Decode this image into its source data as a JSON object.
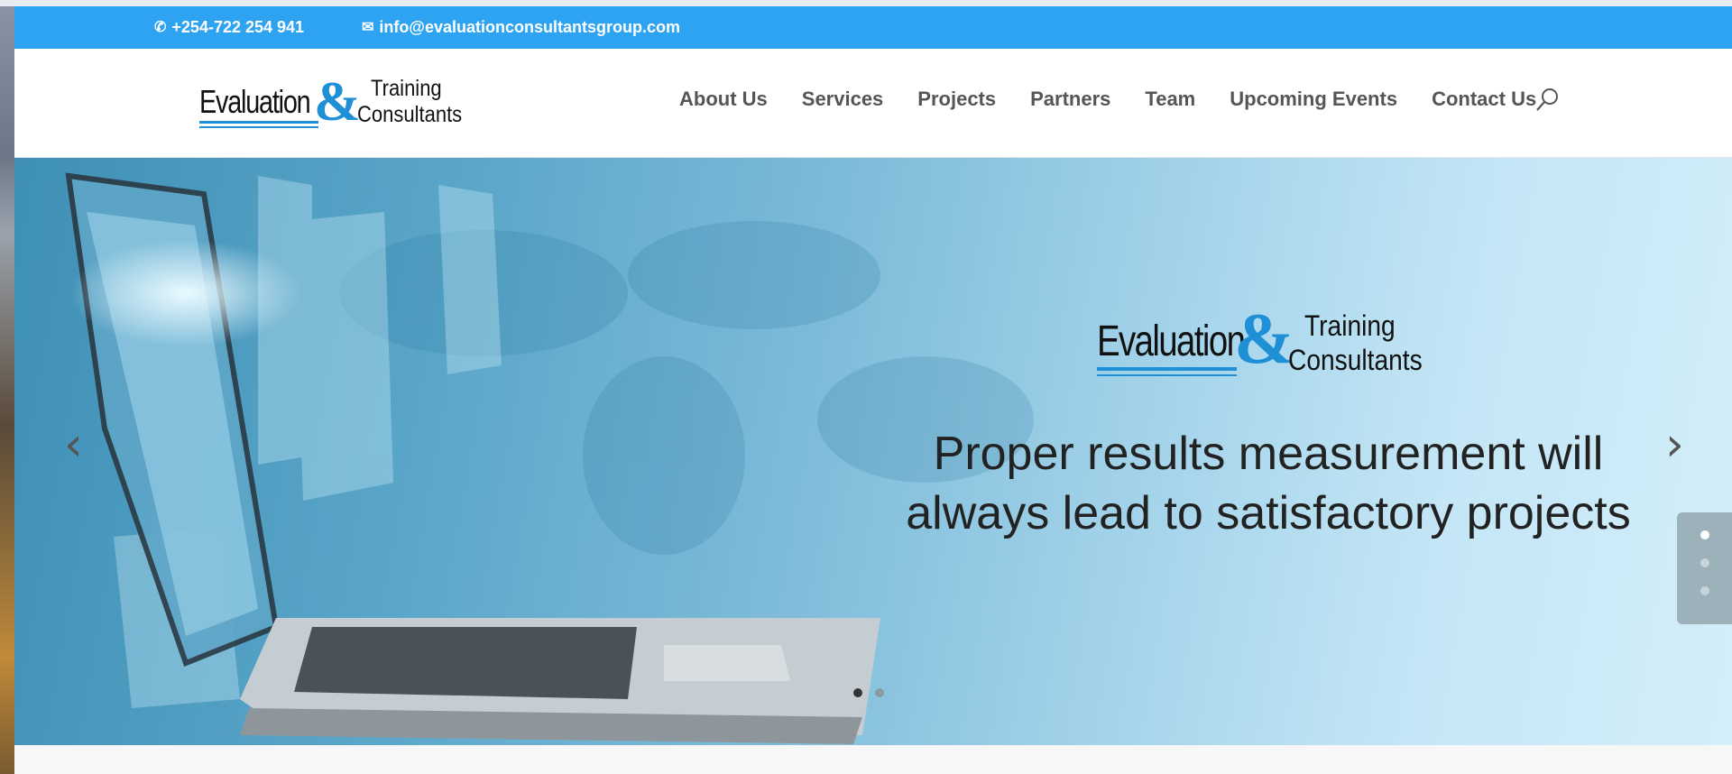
{
  "topbar": {
    "phone": "+254-722 254 941",
    "email": "info@evaluationconsultantsgroup.com",
    "bg_color": "#2ea3f2"
  },
  "logo": {
    "word1": "Evaluation",
    "amp": "&",
    "word2": "Training",
    "word3": "Consultants"
  },
  "nav": {
    "items": [
      "About Us",
      "Services",
      "Projects",
      "Partners",
      "Team",
      "Upcoming Events",
      "Contact Us"
    ],
    "search_icon": "search-icon"
  },
  "hero": {
    "logo": {
      "word1": "Evaluation",
      "amp": "&",
      "word2": "Training",
      "word3": "Consultants"
    },
    "headline_line1": "Proper results measurement will",
    "headline_line2": "always lead to satisfactory projects",
    "prev_arrow": "‹",
    "next_arrow": "›",
    "slider_dots": {
      "count": 2,
      "active": 1
    },
    "side_dots": {
      "count": 3,
      "active": 1
    }
  },
  "colors": {
    "accent": "#1f8fd6",
    "nav_text": "#555555"
  }
}
